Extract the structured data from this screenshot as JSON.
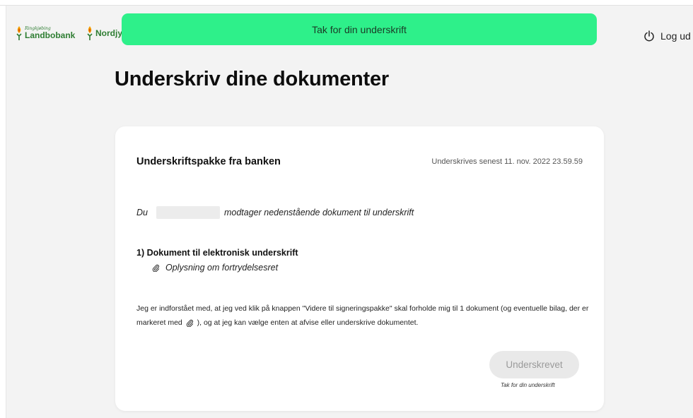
{
  "colors": {
    "brand_green": "#2e7d32",
    "toast_green": "#2ef08a",
    "page_background": "#f3f3f3",
    "button_disabled": "#e9e9e9"
  },
  "header": {
    "logo_1": {
      "small": "Ringkjøbing",
      "big": "Landbobank",
      "icon": "flame-logo-icon"
    },
    "logo_2": {
      "big": "Nordjys",
      "icon": "flame-logo-icon"
    },
    "logout_label": "Log ud",
    "logout_icon": "power-icon"
  },
  "toast": {
    "message": "Tak for din underskrift"
  },
  "page": {
    "title": "Underskriv dine dokumenter"
  },
  "card": {
    "title": "Underskriftspakke fra banken",
    "deadline": "Underskrives senest 11. nov. 2022 23.59.59",
    "recipient_prefix": "Du",
    "recipient_suffix": "modtager nedenstående dokument til underskrift",
    "documents_heading": "1) Dokument til elektronisk underskrift",
    "documents": [
      {
        "label": "Oplysning om fortrydelsesret",
        "icon": "paperclip-icon"
      }
    ],
    "agreement_part1": "Jeg er indforstået med, at jeg ved klik på knappen \"Videre til signeringspakke\" skal forholde mig til 1 dokument (og eventuelle bilag, der er markeret med",
    "agreement_part2": "), og at jeg kan vælge enten at afvise eller underskrive dokumentet.",
    "signed_button_label": "Underskrevet",
    "thanks_note": "Tak for din underskrift"
  }
}
